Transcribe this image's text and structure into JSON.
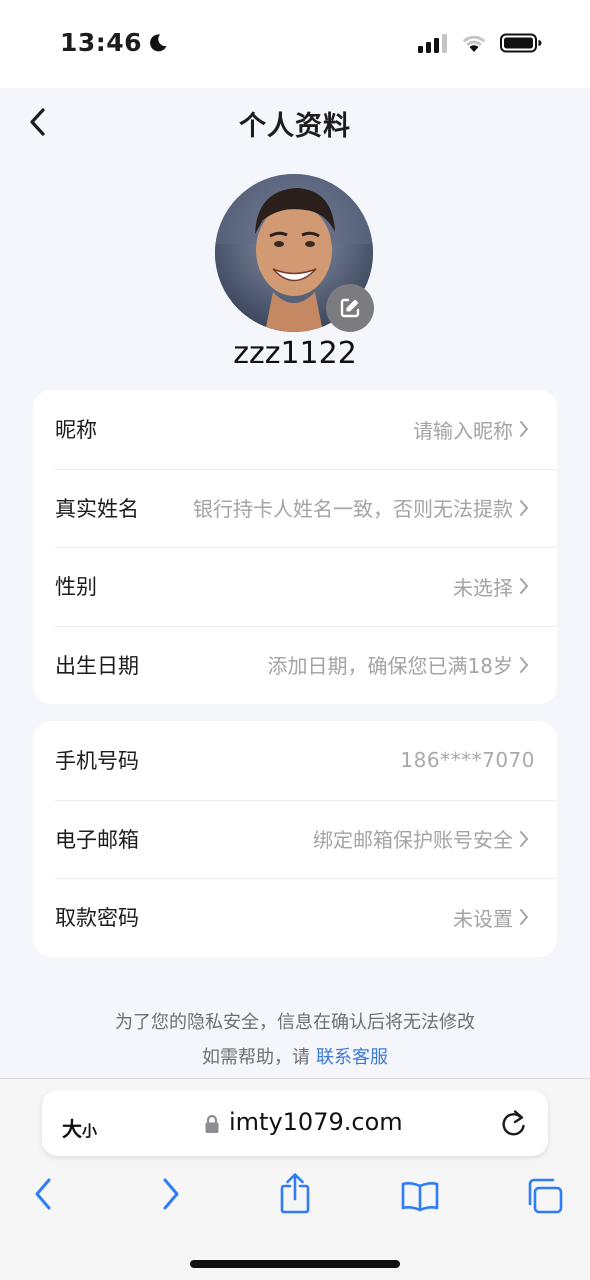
{
  "status_bar": {
    "time": "13:46",
    "icons": [
      "moon-icon",
      "cellular-signal-icon",
      "wifi-icon",
      "battery-icon"
    ]
  },
  "header": {
    "title": "个人资料",
    "back_icon": "chevron-left-icon"
  },
  "profile": {
    "username": "zzz1122",
    "edit_icon": "edit-icon"
  },
  "info_card": {
    "rows": [
      {
        "label": "昵称",
        "value": "请输入昵称"
      },
      {
        "label": "真实姓名",
        "value": "银行持卡人姓名一致，否则无法提款"
      },
      {
        "label": "性别",
        "value": "未选择"
      },
      {
        "label": "出生日期",
        "value": "添加日期，确保您已满18岁"
      }
    ]
  },
  "security_card": {
    "rows": [
      {
        "label": "手机号码",
        "value": "186****7070"
      },
      {
        "label": "电子邮箱",
        "value": "绑定邮箱保护账号安全"
      },
      {
        "label": "取款密码",
        "value": "未设置"
      }
    ]
  },
  "privacy": {
    "note": "为了您的隐私安全，信息在确认后将无法修改",
    "help_prefix": "如需帮助，请",
    "help_link": "联系客服"
  },
  "browser": {
    "text_size_big": "大",
    "text_size_small": "小",
    "url": "imty1079.com",
    "icons": [
      "lock-icon",
      "reload-icon",
      "back-icon",
      "forward-icon",
      "share-icon",
      "bookmarks-icon",
      "tabs-icon"
    ]
  },
  "colors": {
    "page_bg": "#f5f6fb",
    "card_bg": "#ffffff",
    "link": "#3d7bd9",
    "value_text": "#a3a3a8",
    "safari_blue": "#2f7cf6"
  }
}
